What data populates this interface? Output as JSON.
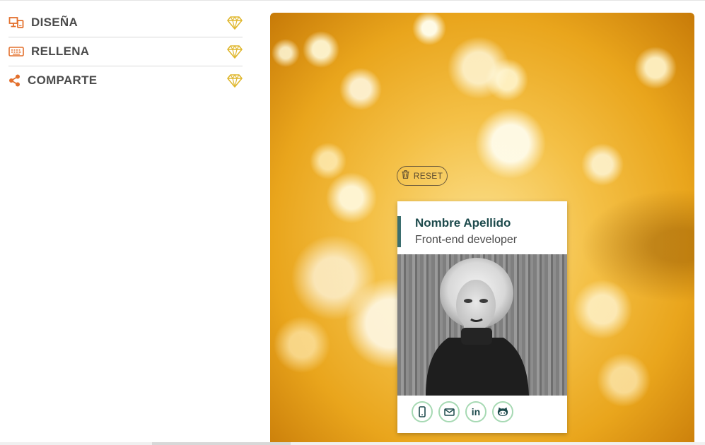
{
  "sidebar": {
    "items": [
      {
        "label": "DISEÑA",
        "icon": "design-icon"
      },
      {
        "label": "RELLENA",
        "icon": "keyboard-icon"
      },
      {
        "label": "COMPARTE",
        "icon": "share-icon"
      }
    ],
    "badge_icon": "diamond-icon"
  },
  "preview": {
    "reset_label": "RESET",
    "card": {
      "name": "Nombre Apellido",
      "job": "Front-end developer",
      "photo_alt": "profile-photo",
      "socials": [
        "phone-icon",
        "email-icon",
        "linkedin-icon",
        "github-icon"
      ],
      "linkedin_text": "in"
    }
  },
  "colors": {
    "accent_orange": "#e3702d",
    "diamond_gold": "#e0b830",
    "card_accent": "#3b6e6f",
    "card_name": "#1d4a4c",
    "social_border": "#a6d9b3"
  }
}
